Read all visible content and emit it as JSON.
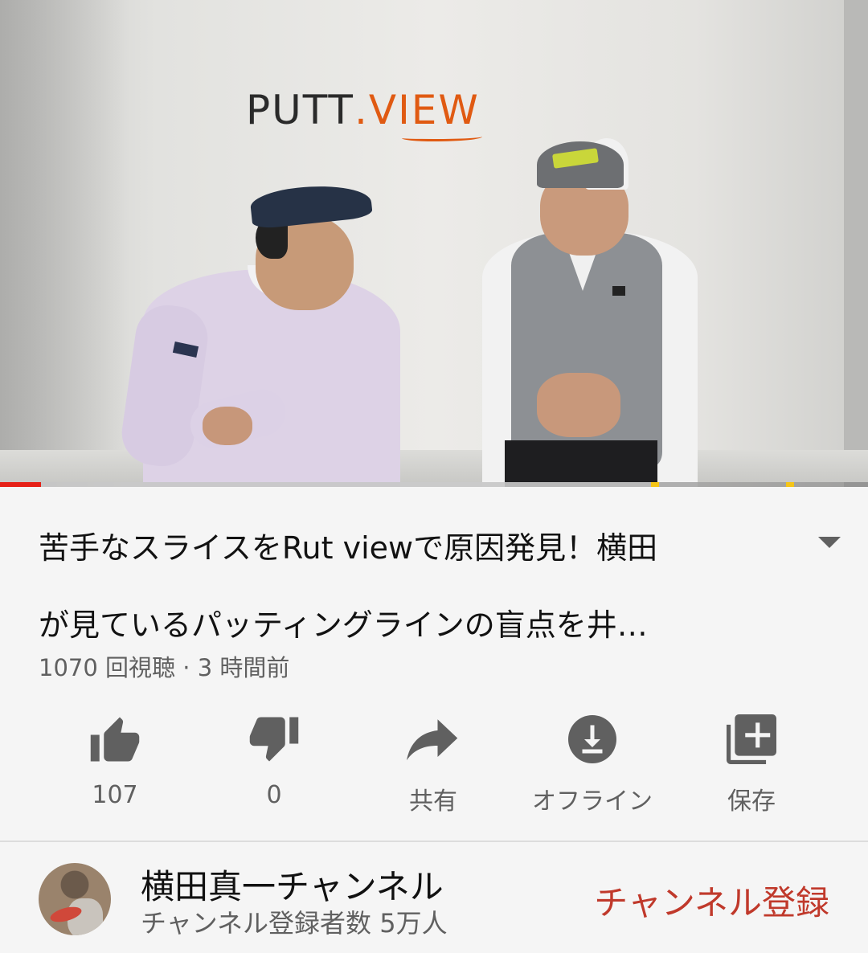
{
  "video": {
    "wall_logo_text": {
      "putt": "PUTT",
      "dot": ".",
      "view": "VIEW"
    },
    "progress_fraction": 0.047,
    "buffered_fraction": 0.75,
    "colors": {
      "played": "#e62117",
      "ad_marker": "#f5c518"
    }
  },
  "title": {
    "line1": "苦手なスライスをRut viewで原因発見！横田",
    "line2": "が見ているパッティングラインの盲点を井…"
  },
  "meta": {
    "views": "1070 回視聴",
    "separator": "·",
    "time": "3 時間前"
  },
  "actions": [
    {
      "icon": "thumbs-up-icon",
      "label": "107"
    },
    {
      "icon": "thumbs-down-icon",
      "label": "0"
    },
    {
      "icon": "share-icon",
      "label": "共有"
    },
    {
      "icon": "download-icon",
      "label": "オフライン"
    },
    {
      "icon": "add-to-playlist-icon",
      "label": "保存"
    }
  ],
  "channel": {
    "name": "横田真一チャンネル",
    "subscribers": "チャンネル登録者数 5万人",
    "subscribe_label": "チャンネル登録",
    "subscribe_color": "#c0392b"
  }
}
